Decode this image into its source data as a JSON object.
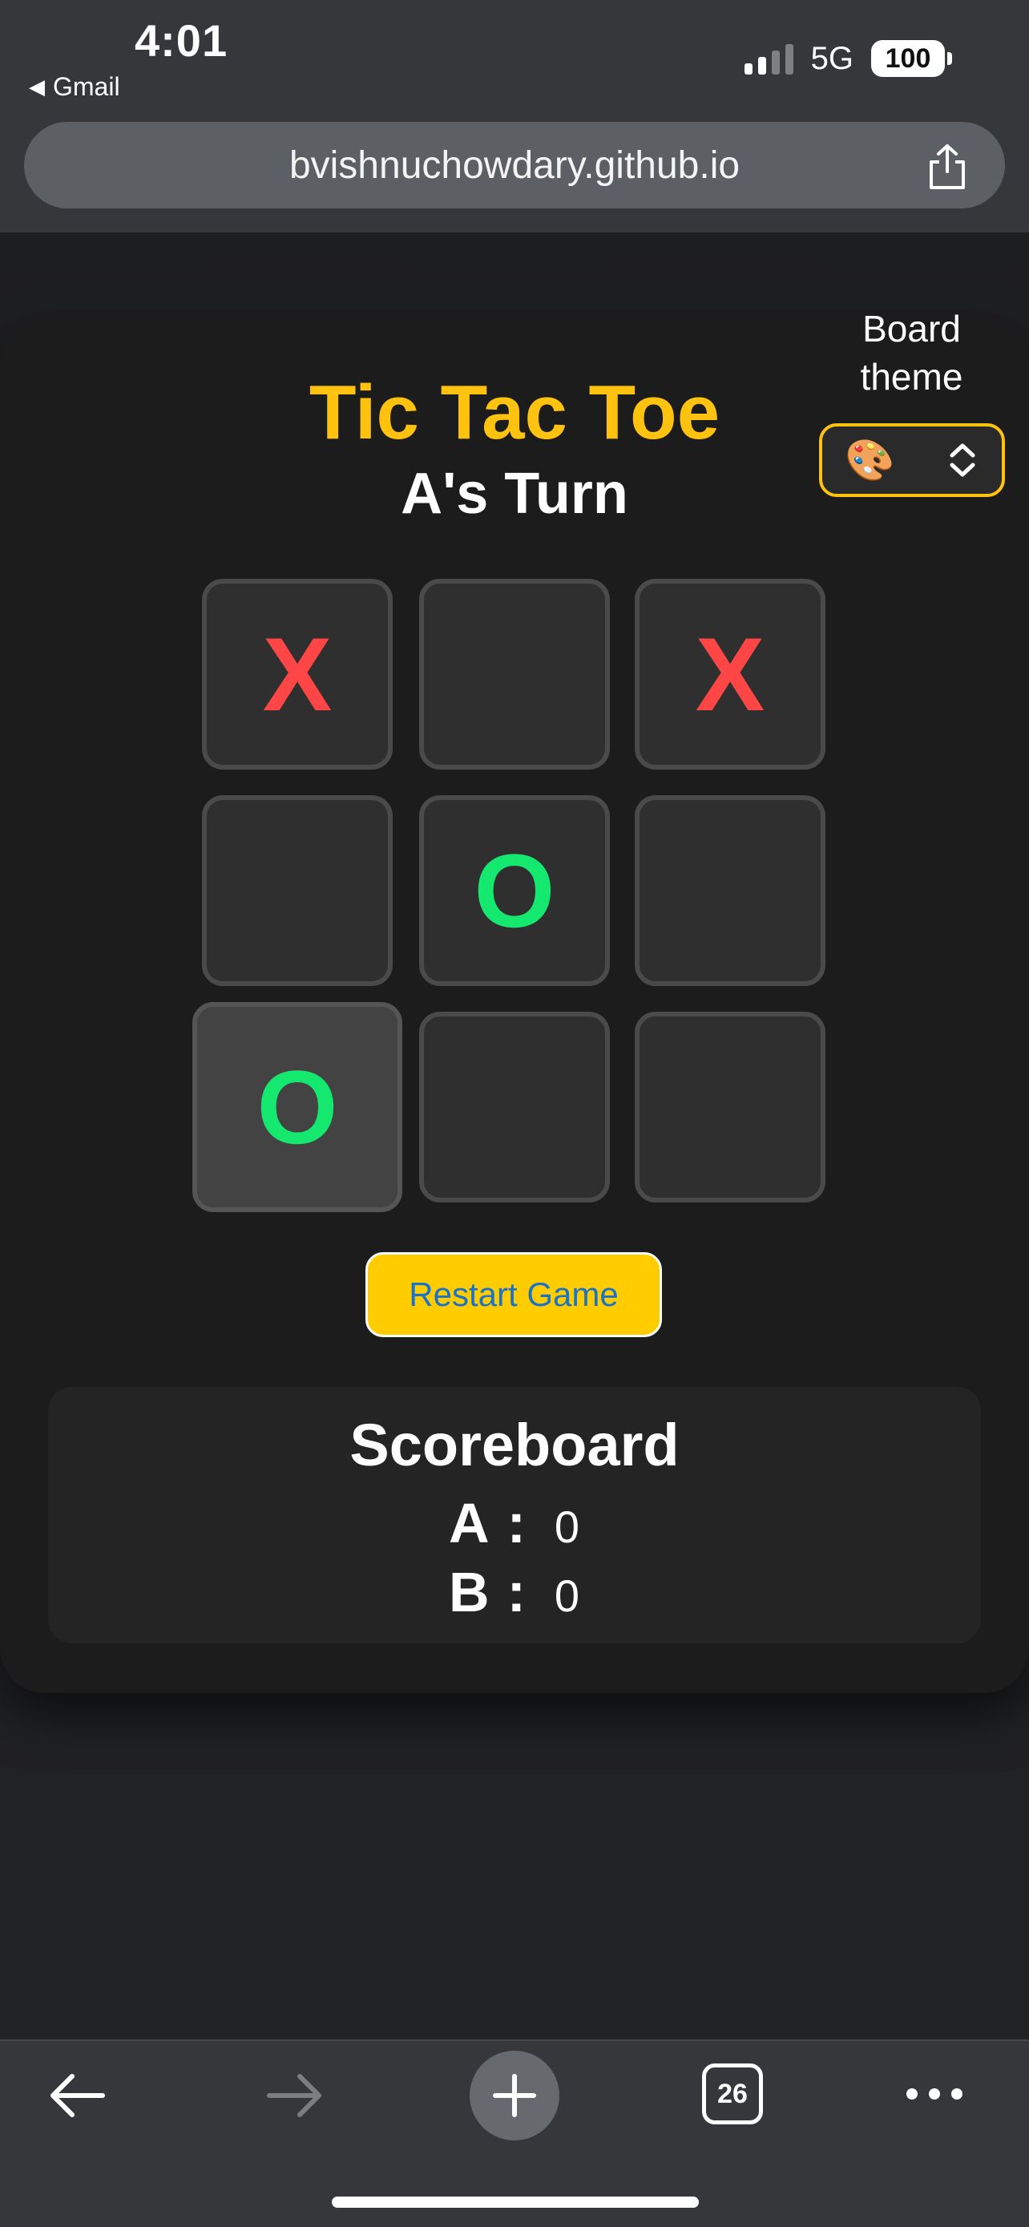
{
  "status_bar": {
    "time": "4:01",
    "back_app": "Gmail",
    "network": "5G",
    "battery": "100"
  },
  "browser": {
    "url": "bvishnuchowdary.github.io"
  },
  "game": {
    "title": "Tic Tac Toe",
    "turn_text": "A's Turn",
    "theme_label": "Board theme",
    "theme_icon": "🎨",
    "board": [
      "X",
      "",
      "X",
      "",
      "O",
      "",
      "O",
      "",
      ""
    ],
    "restart_label": "Restart Game",
    "colors": {
      "title": "#ffc20e",
      "x": "#ff4646",
      "o": "#15e86f",
      "button": "#ffcc00",
      "button_text": "#1a73c9"
    }
  },
  "scoreboard": {
    "title": "Scoreboard",
    "players": [
      {
        "name": "A",
        "sep": ":",
        "score": "0"
      },
      {
        "name": "B",
        "sep": ":",
        "score": "0"
      }
    ]
  },
  "toolbar": {
    "tab_count": "26",
    "icons": [
      "back-arrow-icon",
      "forward-arrow-icon",
      "plus-icon",
      "tabs-icon",
      "more-icon"
    ]
  }
}
